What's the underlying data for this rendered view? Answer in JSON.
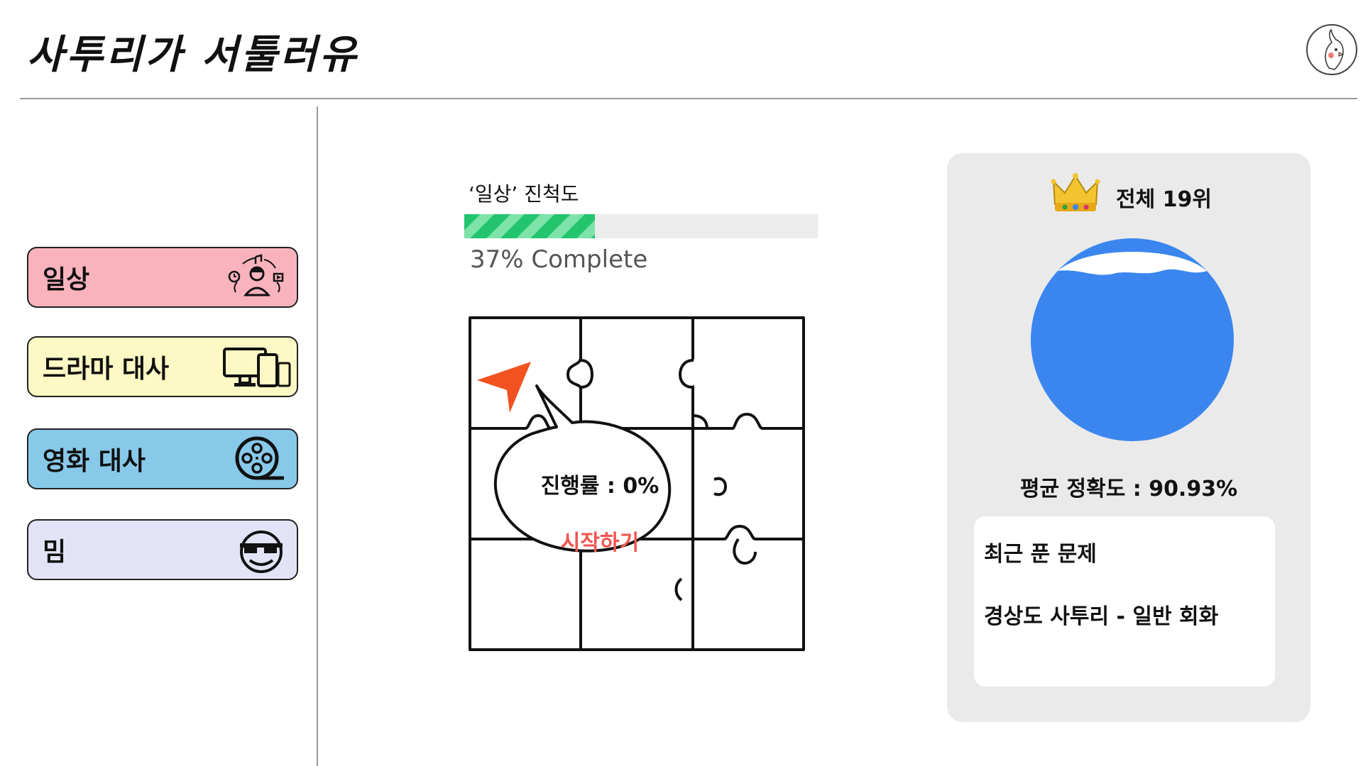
{
  "header": {
    "app_title": "사투리가 서툴러유"
  },
  "sidebar": {
    "items": [
      {
        "label": "일상",
        "icon": "music-person-icon",
        "color": "#f9b3bd"
      },
      {
        "label": "드라마 대사",
        "icon": "devices-icon",
        "color": "#fdf9c4"
      },
      {
        "label": "영화 대사",
        "icon": "film-reel-icon",
        "color": "#88c9ea"
      },
      {
        "label": "밈",
        "icon": "sunglasses-face-icon",
        "color": "#e3e3f8"
      }
    ]
  },
  "main": {
    "progress_label": "‘일상’ 진척도",
    "progress_value": 0.37,
    "progress_text": "37% Complete",
    "bubble": {
      "rate_text": "진행률 : 0%",
      "start_label": "시작하기"
    },
    "accent_color": "#f25550",
    "progress_color": "#23c46e"
  },
  "rank": {
    "title": "전체 19위",
    "accuracy": "평균 정확도 : 90.93%",
    "globe_color": "#3a86ee",
    "recent": {
      "title": "최근 푼 문제",
      "item": "경상도 사투리 - 일반 회화"
    }
  }
}
